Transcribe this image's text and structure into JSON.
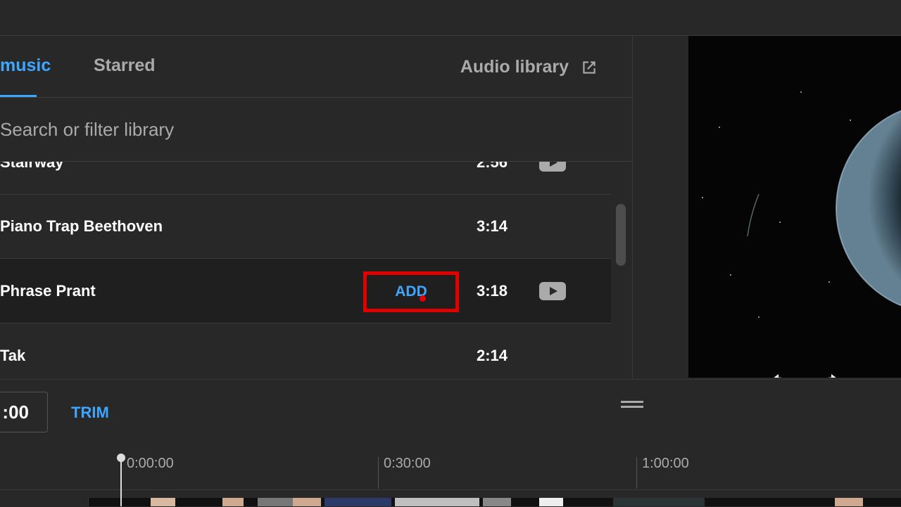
{
  "tabs": [
    {
      "label": "music",
      "active": true
    },
    {
      "label": "Starred",
      "active": false
    }
  ],
  "audio_library_label": "Audio library",
  "search": {
    "placeholder": "Search or filter library"
  },
  "tracks": [
    {
      "title": "Stairway",
      "duration": "2:56",
      "has_preview": true
    },
    {
      "title": "Piano Trap Beethoven",
      "duration": "3:14",
      "has_preview": false
    },
    {
      "title": "Phrase Prant",
      "duration": "3:18",
      "has_preview": true,
      "hovered": true,
      "add_label": "ADD"
    },
    {
      "title": "Tak",
      "duration": "2:14",
      "has_preview": false
    }
  ],
  "player_controls": [
    "play-icon",
    "rewind-10-icon",
    "forward-10-icon",
    "volume-icon"
  ],
  "editor": {
    "time_value": ":00",
    "trim_label": "TRIM"
  },
  "timeline": {
    "labels": [
      "0:00:00",
      "0:30:00",
      "1:00:00"
    ]
  },
  "colors": {
    "accent": "#3ea6ff",
    "highlight": "#e00000",
    "background": "#282828"
  }
}
